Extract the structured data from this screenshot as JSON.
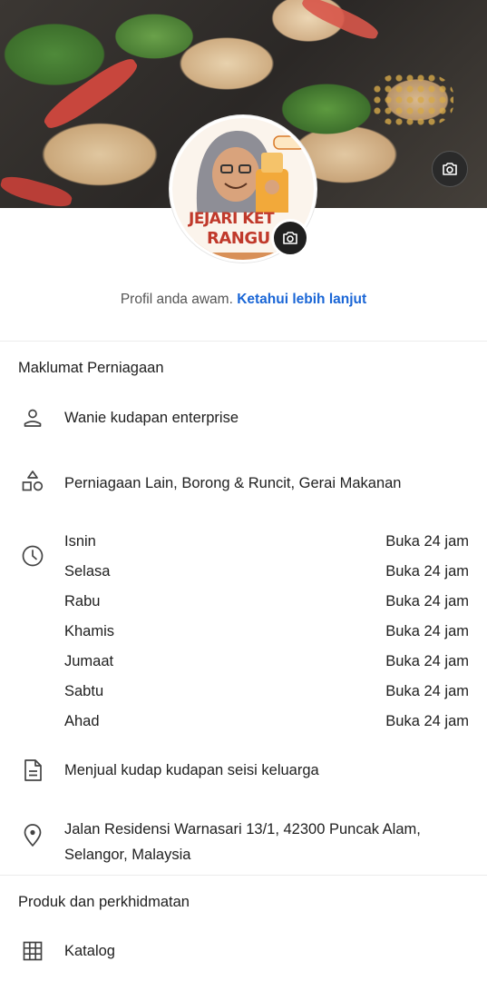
{
  "cover": {
    "camera_icon": "camera-icon"
  },
  "avatar": {
    "logo_text_line1": "JEJARI KET",
    "logo_text_line2": "RANGU",
    "camera_icon": "camera-icon"
  },
  "profile_note": {
    "text": "Profil anda awam.",
    "link": "Ketahui lebih lanjut"
  },
  "business_info": {
    "title": "Maklumat Perniagaan",
    "name": "Wanie kudapan enterprise",
    "categories": "Perniagaan Lain, Borong & Runcit, Gerai Makanan",
    "hours": [
      {
        "day": "Isnin",
        "status": "Buka 24 jam"
      },
      {
        "day": "Selasa",
        "status": "Buka 24 jam"
      },
      {
        "day": "Rabu",
        "status": "Buka 24 jam"
      },
      {
        "day": "Khamis",
        "status": "Buka 24 jam"
      },
      {
        "day": "Jumaat",
        "status": "Buka 24 jam"
      },
      {
        "day": "Sabtu",
        "status": "Buka 24 jam"
      },
      {
        "day": "Ahad",
        "status": "Buka 24 jam"
      }
    ],
    "description": "Menjual kudap kudapan seisi keluarga",
    "address": "Jalan Residensi Warnasari 13/1, 42300 Puncak Alam, Selangor, Malaysia"
  },
  "products": {
    "title": "Produk dan perkhidmatan",
    "catalog": "Katalog"
  },
  "colors": {
    "link": "#1a66d6",
    "text": "#1f1f1f",
    "muted": "#555555"
  }
}
